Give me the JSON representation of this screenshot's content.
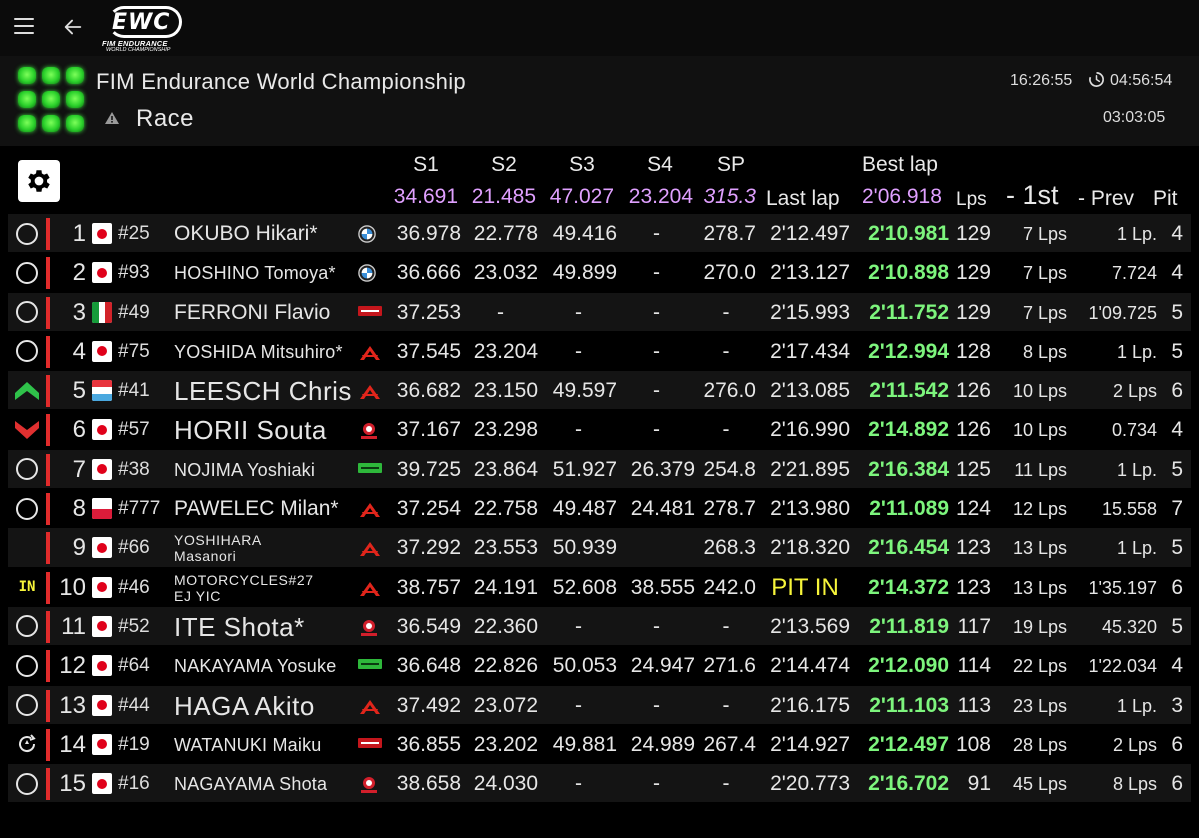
{
  "app": {
    "logo_main": "EWC",
    "logo_line1": "FIM ENDURANCE",
    "logo_line2": "WORLD CHAMPIONSHIP"
  },
  "header": {
    "event_title": "FIM Endurance World Championship",
    "session": "Race",
    "clock": "16:26:55",
    "remaining": "04:56:54",
    "elapsed": "03:03:05"
  },
  "columns": {
    "s1": "S1",
    "s2": "S2",
    "s3": "S3",
    "s4": "S4",
    "sp": "SP",
    "best_lap": "Best lap",
    "last_lap": "Last lap",
    "laps": "Lps",
    "gap_first": "- 1st",
    "gap_prev": "- Prev",
    "pit": "Pit",
    "best_s1": "34.691",
    "best_s2": "21.485",
    "best_s3": "47.027",
    "best_s4": "23.204",
    "best_sp": "315.3",
    "best_lap_time": "2'06.918"
  },
  "colors": {
    "best_purple": "#e0a0ff",
    "best_lap_green": "#7df57d",
    "pit_yellow": "#f7f53a",
    "status_red": "#e12b2b"
  },
  "rows": [
    {
      "status": "ring",
      "pos": "1",
      "flag": "jp",
      "num": "#25",
      "rider": "OKUBO Hikari*",
      "rider_style": "",
      "brand": "bmw",
      "s1": "36.978",
      "s2": "22.778",
      "s3": "49.416",
      "s4": "-",
      "sp": "278.7",
      "last": "2'12.497",
      "best": "2'10.981",
      "laps": "129",
      "gap1": "7 Lps",
      "gapp": "1 Lp.",
      "pit": "4"
    },
    {
      "status": "ring",
      "pos": "2",
      "flag": "jp",
      "num": "#93",
      "rider": "HOSHINO Tomoya*",
      "rider_style": "sm",
      "brand": "bmw",
      "s1": "36.666",
      "s2": "23.032",
      "s3": "49.899",
      "s4": "-",
      "sp": "270.0",
      "last": "2'13.127",
      "best": "2'10.898",
      "laps": "129",
      "gap1": "7 Lps",
      "gapp": "7.724",
      "pit": "4"
    },
    {
      "status": "ring",
      "pos": "3",
      "flag": "it",
      "num": "#49",
      "rider": "FERRONI Flavio",
      "rider_style": "",
      "brand": "aprilia",
      "s1": "37.253",
      "s2": "-",
      "s3": "-",
      "s4": "-",
      "sp": "-",
      "last": "2'15.993",
      "best": "2'11.752",
      "laps": "129",
      "gap1": "7 Lps",
      "gapp": "1'09.725",
      "pit": "5"
    },
    {
      "status": "ring",
      "pos": "4",
      "flag": "jp",
      "num": "#75",
      "rider": "YOSHIDA Mitsuhiro*",
      "rider_style": "sm",
      "brand": "honda",
      "s1": "37.545",
      "s2": "23.204",
      "s3": "-",
      "s4": "-",
      "sp": "-",
      "last": "2'17.434",
      "best": "2'12.994",
      "laps": "128",
      "gap1": "8 Lps",
      "gapp": "1 Lp.",
      "pit": "5"
    },
    {
      "status": "up",
      "pos": "5",
      "flag": "lu",
      "num": "#41",
      "rider": "LEESCH Chris",
      "rider_style": "lg",
      "brand": "honda",
      "s1": "36.682",
      "s2": "23.150",
      "s3": "49.597",
      "s4": "-",
      "sp": "276.0",
      "last": "2'13.085",
      "best": "2'11.542",
      "laps": "126",
      "gap1": "10 Lps",
      "gapp": "2 Lps",
      "pit": "6"
    },
    {
      "status": "down",
      "pos": "6",
      "flag": "jp",
      "num": "#57",
      "rider": "HORII Souta",
      "rider_style": "lg",
      "brand": "yamaha",
      "s1": "37.167",
      "s2": "23.298",
      "s3": "-",
      "s4": "-",
      "sp": "-",
      "last": "2'16.990",
      "best": "2'14.892",
      "laps": "126",
      "gap1": "10 Lps",
      "gapp": "0.734",
      "pit": "4"
    },
    {
      "status": "ring",
      "pos": "7",
      "flag": "jp",
      "num": "#38",
      "rider": "NOJIMA Yoshiaki",
      "rider_style": "sm",
      "brand": "kawasaki",
      "s1": "39.725",
      "s2": "23.864",
      "s3": "51.927",
      "s4": "26.379",
      "sp": "254.8",
      "last": "2'21.895",
      "best": "2'16.384",
      "laps": "125",
      "gap1": "11 Lps",
      "gapp": "1 Lp.",
      "pit": "5"
    },
    {
      "status": "ring",
      "pos": "8",
      "flag": "pl",
      "num": "#777",
      "rider": "PAWELEC Milan*",
      "rider_style": "",
      "brand": "honda",
      "s1": "37.254",
      "s2": "22.758",
      "s3": "49.487",
      "s4": "24.481",
      "sp": "278.7",
      "last": "2'13.980",
      "best": "2'11.089",
      "laps": "124",
      "gap1": "12 Lps",
      "gapp": "15.558",
      "pit": "7"
    },
    {
      "status": "none",
      "pos": "9",
      "flag": "jp",
      "num": "#66",
      "rider": "YOSHIHARA",
      "rider2": "Masanori",
      "rider_style": "two",
      "brand": "honda",
      "s1": "37.292",
      "s2": "23.553",
      "s3": "50.939",
      "s4": "",
      "sp": "268.3",
      "last": "2'18.320",
      "best": "2'16.454",
      "laps": "123",
      "gap1": "13 Lps",
      "gapp": "1 Lp.",
      "pit": "5"
    },
    {
      "status": "in",
      "status_text": "IN",
      "pos": "10",
      "flag": "jp",
      "num": "#46",
      "rider": "MOTORCYCLES#27",
      "rider2": "EJ YIC",
      "rider_style": "two",
      "brand": "honda",
      "s1": "38.757",
      "s2": "24.191",
      "s3": "52.608",
      "s4": "38.555",
      "sp": "242.0",
      "last": "PIT IN",
      "best": "2'14.372",
      "laps": "123",
      "gap1": "13 Lps",
      "gapp": "1'35.197",
      "pit": "6"
    },
    {
      "status": "ring",
      "pos": "11",
      "flag": "jp",
      "num": "#52",
      "rider": "ITE Shota*",
      "rider_style": "lg",
      "brand": "yamaha",
      "s1": "36.549",
      "s2": "22.360",
      "s3": "-",
      "s4": "-",
      "sp": "-",
      "last": "2'13.569",
      "best": "2'11.819",
      "laps": "117",
      "gap1": "19 Lps",
      "gapp": "45.320",
      "pit": "5"
    },
    {
      "status": "ring",
      "pos": "12",
      "flag": "jp",
      "num": "#64",
      "rider": "NAKAYAMA Yosuke",
      "rider_style": "sm",
      "brand": "kawasaki",
      "s1": "36.648",
      "s2": "22.826",
      "s3": "50.053",
      "s4": "24.947",
      "sp": "271.6",
      "last": "2'14.474",
      "best": "2'12.090",
      "laps": "114",
      "gap1": "22 Lps",
      "gapp": "1'22.034",
      "pit": "4"
    },
    {
      "status": "ring",
      "pos": "13",
      "flag": "jp",
      "num": "#44",
      "rider": "HAGA Akito",
      "rider_style": "lg",
      "brand": "honda",
      "s1": "37.492",
      "s2": "23.072",
      "s3": "-",
      "s4": "-",
      "sp": "-",
      "last": "2'16.175",
      "best": "2'11.103",
      "laps": "113",
      "gap1": "23 Lps",
      "gapp": "1 Lp.",
      "pit": "3"
    },
    {
      "status": "refuel",
      "pos": "14",
      "flag": "jp",
      "num": "#19",
      "rider": "WATANUKI Maiku",
      "rider_style": "sm",
      "brand": "aprilia",
      "s1": "36.855",
      "s2": "23.202",
      "s3": "49.881",
      "s4": "24.989",
      "sp": "267.4",
      "last": "2'14.927",
      "best": "2'12.497",
      "laps": "108",
      "gap1": "28 Lps",
      "gapp": "2 Lps",
      "pit": "6"
    },
    {
      "status": "ring",
      "pos": "15",
      "flag": "jp",
      "num": "#16",
      "rider": "NAGAYAMA Shota",
      "rider_style": "sm",
      "brand": "yamaha",
      "s1": "38.658",
      "s2": "24.030",
      "s3": "-",
      "s4": "-",
      "sp": "-",
      "last": "2'20.773",
      "best": "2'16.702",
      "laps": "91",
      "gap1": "45 Lps",
      "gapp": "8 Lps",
      "pit": "6"
    }
  ]
}
